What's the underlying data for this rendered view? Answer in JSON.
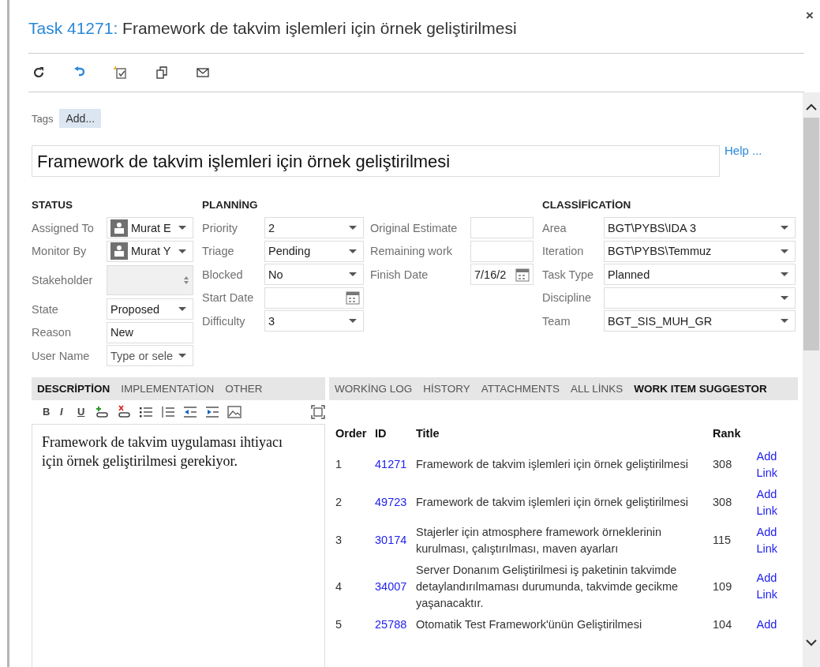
{
  "header": {
    "prefix": "Task 41271:",
    "title": "Framework de takvim işlemleri için örnek geliştirilmesi",
    "close": "×"
  },
  "tags": {
    "label": "Tags",
    "button": "Add..."
  },
  "title_field": {
    "value": "Framework de takvim işlemleri için örnek geliştirilmesi"
  },
  "help_link": "Help ...",
  "status": {
    "heading": "STATUS",
    "fields": [
      {
        "label": "Assigned To",
        "value": "Murat E",
        "kind": "person",
        "disabled": false
      },
      {
        "label": "Monitor By",
        "value": "Murat Y",
        "kind": "person",
        "disabled": false
      },
      {
        "label": "Stakeholder",
        "kind": "spinner",
        "disabled": true
      },
      {
        "label": "State",
        "value": "Proposed",
        "kind": "select",
        "disabled": false
      },
      {
        "label": "Reason",
        "value": "New",
        "kind": "text",
        "disabled": false
      },
      {
        "label": "User Name",
        "placeholder": "Type or sele",
        "kind": "select",
        "disabled": false
      }
    ]
  },
  "planning": {
    "heading": "PLANNİNG",
    "columns": [
      {
        "fields": [
          {
            "label": "Priority",
            "value": "2",
            "kind": "select"
          },
          {
            "label": "Triage",
            "value": "Pending",
            "kind": "select"
          },
          {
            "label": "Blocked",
            "value": "No",
            "kind": "select"
          },
          {
            "label": "Start Date",
            "kind": "date"
          },
          {
            "label": "Difficulty",
            "value": "3",
            "kind": "select"
          }
        ]
      },
      {
        "fields": [
          {
            "label": "Original Estimate",
            "kind": "text"
          },
          {
            "label": "Remaining work",
            "kind": "text"
          },
          {
            "label": "Finish Date",
            "value": "7/16/2",
            "kind": "date"
          }
        ]
      }
    ]
  },
  "classification": {
    "heading": "CLASSİFİCATİON",
    "fields": [
      {
        "label": "Area",
        "value": "BGT\\PYBS\\IDA 3",
        "kind": "select"
      },
      {
        "label": "Iteration",
        "value": "BGT\\PYBS\\Temmuz",
        "kind": "select"
      },
      {
        "label": "Task Type",
        "value": "Planned",
        "kind": "select"
      },
      {
        "label": "Discipline",
        "kind": "select"
      },
      {
        "label": "Team",
        "value": "BGT_SIS_MUH_GR",
        "kind": "select"
      }
    ]
  },
  "left_tabs": [
    {
      "label": "DESCRİPTİON",
      "selected": true
    },
    {
      "label": "IMPLEMENTATİON",
      "selected": false
    },
    {
      "label": "OTHER",
      "selected": false
    }
  ],
  "editor_toolbar": {
    "bold": "B",
    "italic": "I",
    "underline": "U"
  },
  "description": "Framework de takvim uygulaması ihtiyacı için örnek geliştirilmesi gerekiyor.",
  "right_tabs": [
    {
      "label": "WORKİNG LOG",
      "selected": false
    },
    {
      "label": "HİSTORY",
      "selected": false
    },
    {
      "label": "ATTACHMENTS",
      "selected": false
    },
    {
      "label": "ALL LİNKS",
      "selected": false
    },
    {
      "label": "WORK ITEM SUGGESTOR",
      "selected": true
    }
  ],
  "table": {
    "columns": [
      "Order",
      "ID",
      "Title",
      "Rank"
    ],
    "rows": [
      {
        "order": "1",
        "id": "41271",
        "title": "Framework de takvim işlemleri için örnek geliştirilmesi",
        "rank": "308",
        "link": "Add Link"
      },
      {
        "order": "2",
        "id": "49723",
        "title": "Framework de takvim işlemleri için örnek geliştirilmesi",
        "rank": "308",
        "link": "Add Link"
      },
      {
        "order": "3",
        "id": "30174",
        "title": "Stajerler için atmosphere framework örneklerinin kurulması, çalıştırılması, maven ayarları",
        "rank": "115",
        "link": "Add Link"
      },
      {
        "order": "4",
        "id": "34007",
        "title": "Server Donanım Geliştirilmesi iş paketinin takvimde detaylandırılmaması durumunda, takvimde gecikme yaşanacaktır.",
        "rank": "109",
        "link": "Add Link"
      },
      {
        "order": "5",
        "id": "25788",
        "title": "Otomatik Test Framework'ünün Geliştirilmesi",
        "rank": "104",
        "link": "Add"
      }
    ]
  }
}
